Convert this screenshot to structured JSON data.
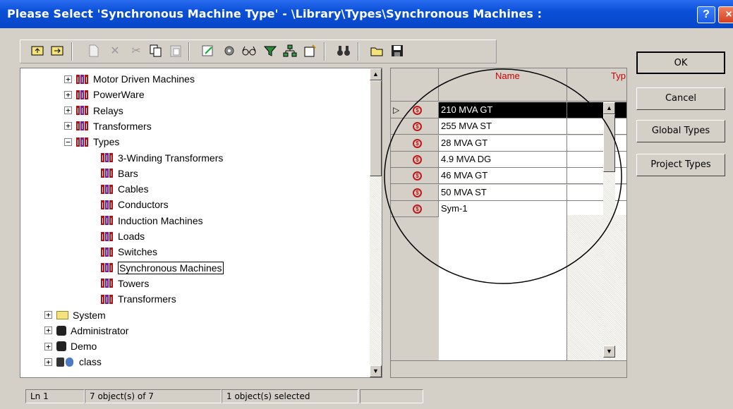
{
  "window": {
    "title": "Please Select 'Synchronous Machine Type' - \\Library\\Types\\Synchronous Machines :",
    "help_glyph": "?",
    "close_glyph": "×"
  },
  "toolbar": {
    "icons": [
      "folder-up-icon",
      "folder-up-alt-icon",
      "new-icon",
      "delete-icon",
      "cut-icon",
      "copy-icon",
      "paste-icon",
      "edit-icon",
      "settings-icon",
      "glasses-icon",
      "filter-icon",
      "hierarchy-icon",
      "new-object-icon",
      "find-icon",
      "open-icon",
      "save-icon"
    ]
  },
  "tree": {
    "items": [
      {
        "label": "Motor Driven Machines",
        "icon": "library-icon",
        "expander": "+"
      },
      {
        "label": "PowerWare",
        "icon": "library-icon",
        "expander": "+"
      },
      {
        "label": "Relays",
        "icon": "library-icon",
        "expander": "+"
      },
      {
        "label": "Transformers",
        "icon": "library-icon",
        "expander": "+"
      },
      {
        "label": "Types",
        "icon": "library-icon",
        "expander": "−"
      },
      {
        "label": "3-Winding Transformers",
        "icon": "library-icon"
      },
      {
        "label": "Bars",
        "icon": "library-icon"
      },
      {
        "label": "Cables",
        "icon": "library-icon"
      },
      {
        "label": "Conductors",
        "icon": "library-icon"
      },
      {
        "label": "Induction Machines",
        "icon": "library-icon"
      },
      {
        "label": "Loads",
        "icon": "library-icon"
      },
      {
        "label": "Switches",
        "icon": "library-icon"
      },
      {
        "label": "Synchronous Machines",
        "icon": "library-icon",
        "selected": true
      },
      {
        "label": "Towers",
        "icon": "library-icon"
      },
      {
        "label": "Transformers",
        "icon": "library-icon"
      },
      {
        "label": "System",
        "icon": "folder-icon",
        "expander": "+"
      },
      {
        "label": "Administrator",
        "icon": "user-icon",
        "expander": "+"
      },
      {
        "label": "Demo",
        "icon": "user-icon",
        "expander": "+"
      },
      {
        "label": "class",
        "icon": "class-icon",
        "expander": "+"
      }
    ]
  },
  "grid": {
    "columns": [
      "Name",
      "Typ"
    ],
    "rows": [
      {
        "name": "210 MVA GT",
        "selected": true
      },
      {
        "name": "255 MVA ST"
      },
      {
        "name": "28 MVA GT"
      },
      {
        "name": "4.9 MVA DG"
      },
      {
        "name": "46 MVA GT"
      },
      {
        "name": "50 MVA ST"
      },
      {
        "name": "Sym-1"
      }
    ]
  },
  "buttons": {
    "ok": "OK",
    "cancel": "Cancel",
    "global_types": "Global Types",
    "project_types": "Project Types"
  },
  "status": {
    "line": "Ln 1",
    "objects": "7 object(s) of 7",
    "selected": "1 object(s) selected",
    "extra": ""
  },
  "colors": {
    "titlebar": "#0a50d8",
    "library_icon": "#b01010",
    "sync_icon": "#c01818"
  }
}
